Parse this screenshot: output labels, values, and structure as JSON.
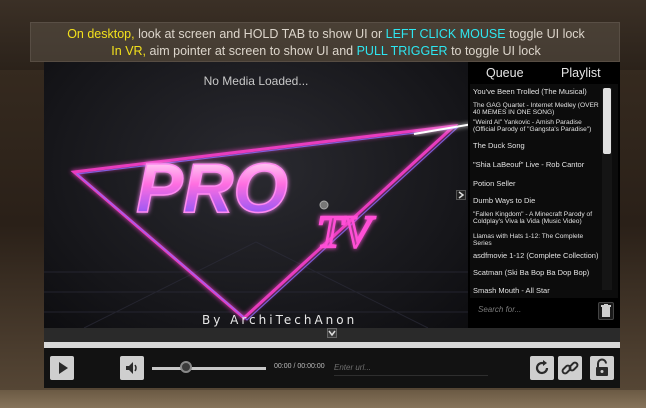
{
  "banner": {
    "line1": [
      {
        "text": "On desktop, ",
        "color": "yellow"
      },
      {
        "text": "look at screen and HOLD TAB ",
        "color": "white"
      },
      {
        "text": "to show UI or ",
        "color": "white"
      },
      {
        "text": "LEFT CLICK MOUSE ",
        "color": "cyan"
      },
      {
        "text": "toggle UI lock",
        "color": "white"
      }
    ],
    "line2": [
      {
        "text": "In VR, ",
        "color": "yellow"
      },
      {
        "text": "aim pointer at screen ",
        "color": "white"
      },
      {
        "text": "to show UI and  ",
        "color": "white"
      },
      {
        "text": "PULL TRIGGER ",
        "color": "cyan"
      },
      {
        "text": "to toggle UI lock",
        "color": "white"
      }
    ]
  },
  "video": {
    "status": "No Media Loaded...",
    "logo_text": "PRO TV",
    "credit": "By ArchiTechAnon"
  },
  "sidebar": {
    "tab_queue": "Queue",
    "tab_playlist": "Playlist",
    "items": [
      "You've Been Trolled (The Musical)",
      "The GAG Quartet - Internet Medley (OVER 40 MEMES IN ONE SONG)",
      "\"Weird Al\" Yankovic - Amish Paradise (Official Parody of \"Gangsta's Paradise\")",
      "The Duck Song",
      "\"Shia LaBeouf\" Live - Rob Cantor",
      "Potion Seller",
      "Dumb Ways to Die",
      "\"Fallen Kingdom\" - A Minecraft Parody of Coldplay's Viva la Vida (Music Video)",
      "Llamas with Hats 1-12: The Complete Series",
      "asdfmovie 1-12 (Complete Collection)",
      "Scatman (Ski Ba Bop Ba Dop Bop)",
      "Smash Mouth - All Star"
    ],
    "search_placeholder": "Search for..."
  },
  "controls": {
    "time": "00:00 / 00:00:00",
    "url_placeholder": "Enter url...",
    "volume_level": 0.3
  },
  "colors": {
    "yellow": "#f2e01c",
    "cyan": "#2ee6f0",
    "white": "#ddd6cc",
    "neon_pink": "#ff3fd0",
    "neon_blue": "#8a6cff"
  },
  "icons": {
    "play": "play-icon",
    "volume": "volume-icon",
    "reload": "reload-icon",
    "link": "link-icon",
    "lock": "lock-icon",
    "trash": "trash-icon",
    "collapse": "chevron-right-icon",
    "expand": "chevron-down-icon"
  }
}
